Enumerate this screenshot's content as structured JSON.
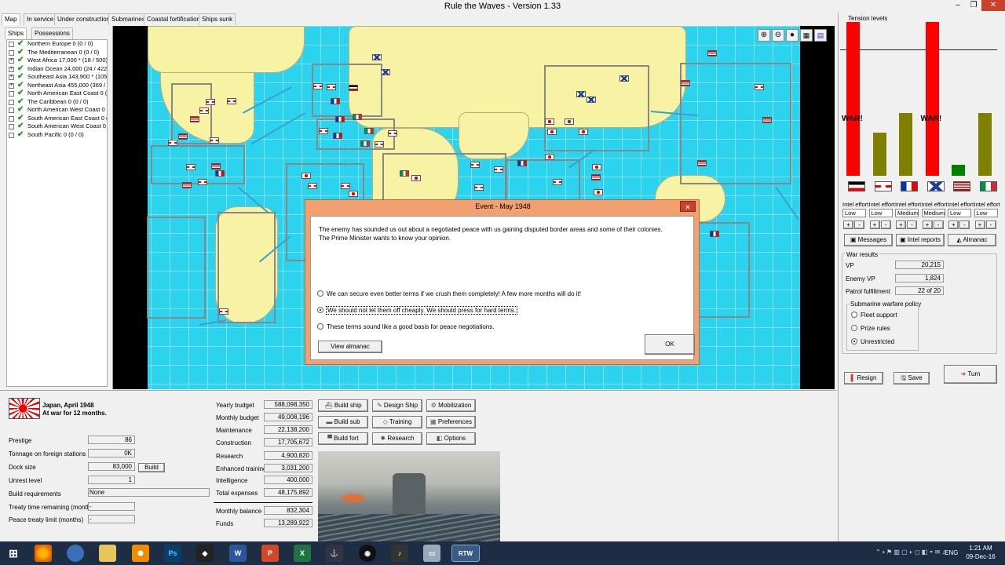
{
  "app": {
    "title": "Rule the Waves - Version 1.33"
  },
  "main_tabs": [
    "Map",
    "In service",
    "Under construction",
    "Submarines",
    "Coastal fortifications",
    "Ships sunk"
  ],
  "side_tabs": [
    "Ships",
    "Possessions"
  ],
  "tree": [
    {
      "label": "Northern Europe 0 (0 / 0)",
      "expand": false
    },
    {
      "label": "The Mediterranean 0 (0 / 0)",
      "expand": false
    },
    {
      "label": "West Africa 17,000 * (18 / 500)",
      "expand": true
    },
    {
      "label": "Indian Ocean 24,000 (24 / 422",
      "expand": true
    },
    {
      "label": "Southeast Asia 143,900 * (105",
      "expand": true
    },
    {
      "label": "Northeast Asia 455,000 (369 /",
      "expand": true
    },
    {
      "label": "North American East Coast 0 (0",
      "expand": false
    },
    {
      "label": "The Caribbean 0 (0 / 0)",
      "expand": false
    },
    {
      "label": "North American West Coast 0 (",
      "expand": false
    },
    {
      "label": "South American East Coast 0 (",
      "expand": false
    },
    {
      "label": "South American West Coast 0 (",
      "expand": false
    },
    {
      "label": "South Pacific 0 (0 / 0)",
      "expand": false
    }
  ],
  "dialog": {
    "title": "Event - May 1948",
    "message": "The enemy has sounded us out about a negotiated peace with us gaining disputed border areas and some of their colonies. The Prime Minister wants to know your opinion.",
    "options": [
      "We can secure even better terms if we crush them completely! A few more months will do it!",
      "We should not let them off cheaply. We should press for hard terms.",
      "These terms sound like a good basis for peace negotiations."
    ],
    "selected": 1,
    "view_almanac": "View almanac",
    "ok": "OK"
  },
  "tension": {
    "title": "Tension levels",
    "war_label": "WAR!",
    "nations": [
      {
        "flag": "de",
        "level": 1.0,
        "war": true,
        "color": "#ff0000",
        "effort": "Low"
      },
      {
        "flag": "uk",
        "level": 0.28,
        "war": false,
        "color": "#808000",
        "effort": "Low"
      },
      {
        "flag": "fr",
        "level": 0.41,
        "war": false,
        "color": "#808000",
        "effort": "Medium"
      },
      {
        "flag": "ru",
        "level": 1.0,
        "war": true,
        "color": "#ff0000",
        "effort": "Medium"
      },
      {
        "flag": "us",
        "level": 0.07,
        "war": false,
        "color": "#008000",
        "effort": "Low"
      },
      {
        "flag": "it",
        "level": 0.41,
        "war": false,
        "color": "#808000",
        "effort": "Low"
      }
    ],
    "intel_label": "Intel effort",
    "plus": "+",
    "minus": "-"
  },
  "side_buttons": {
    "messages": "Messages",
    "intel": "Intel reports",
    "almanac": "Almanac"
  },
  "war_results": {
    "title": "War results",
    "rows": [
      {
        "label": "VP",
        "value": "20,215"
      },
      {
        "label": "Enemy VP",
        "value": "1,824"
      },
      {
        "label": "Patrol fulfillment",
        "value": "22 of 20"
      }
    ]
  },
  "sub_policy": {
    "title": "Submarine warfare policy",
    "options": [
      "Fleet support",
      "Prize rules",
      "Unrestricted"
    ],
    "selected": 2
  },
  "bottom_buttons": {
    "resign": "Resign",
    "save": "Save",
    "turn": "Turn"
  },
  "nation": {
    "name": "Japan, April 1948",
    "status": "At war for 12 months."
  },
  "stats": [
    {
      "label": "Prestige",
      "value": "86"
    },
    {
      "label": "Tonnage on foreign stations",
      "value": "0K"
    },
    {
      "label": "Dock size",
      "value": "83,000"
    },
    {
      "label": "Unrest level",
      "value": "1"
    },
    {
      "label": "Build requirements",
      "value": "None"
    },
    {
      "label": "Treaty time remaining (months)",
      "value": "-"
    },
    {
      "label": "Peace treaty limit (months)",
      "value": "-"
    }
  ],
  "build_label": "Build",
  "budget": [
    {
      "label": "Yearly budget",
      "value": "588,098,350"
    },
    {
      "label": "Monthly budget",
      "value": "49,008,196"
    },
    {
      "label": "Maintenance",
      "value": "22,138,200"
    },
    {
      "label": "Construction",
      "value": "17,705,672"
    },
    {
      "label": "Research",
      "value": "4,900,820"
    },
    {
      "label": "Enhanced training",
      "value": "3,031,200"
    },
    {
      "label": "Intelligence",
      "value": "400,000"
    },
    {
      "label": "Total expenses",
      "value": "48,175,892"
    },
    {
      "label": "Monthly balance",
      "value": "832,304"
    },
    {
      "label": "Funds",
      "value": "13,289,922"
    }
  ],
  "action_buttons": [
    "Build ship",
    "Design Ship",
    "Mobilization",
    "Build sub",
    "Training",
    "Preferences",
    "Build fort",
    "Research",
    "Options"
  ],
  "taskbar": {
    "lang": "ENG",
    "time": "1:21 AM",
    "date": "09-Dec-16"
  }
}
